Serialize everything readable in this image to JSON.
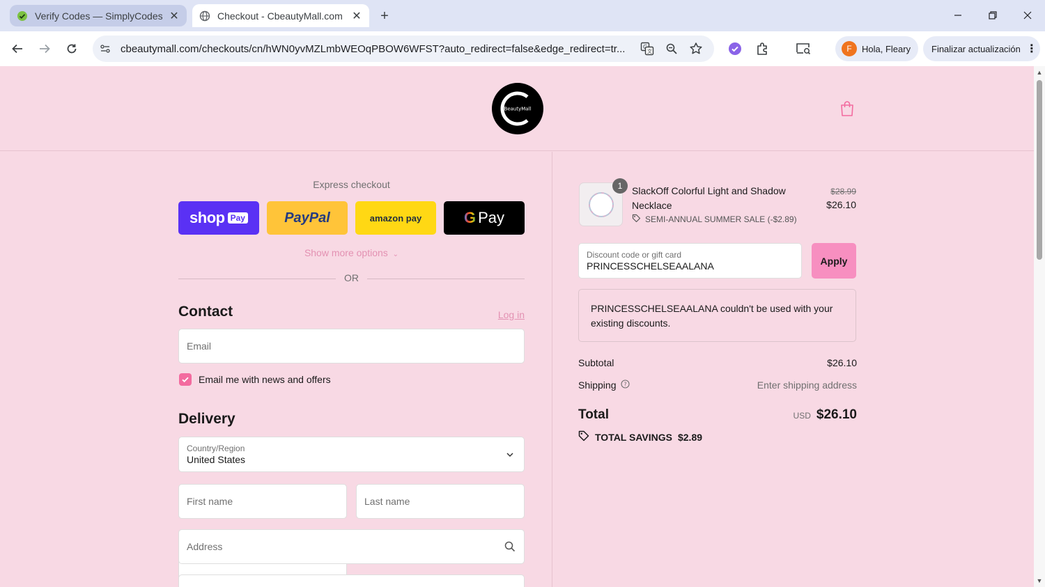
{
  "browser": {
    "tabs": [
      {
        "title": "Verify Codes — SimplyCodes",
        "active": false,
        "icon": "simplycodes-icon"
      },
      {
        "title": "Checkout - CbeautyMall.com",
        "active": true,
        "icon": "globe-icon"
      }
    ],
    "url": "cbeautymall.com/checkouts/cn/hWN0yvMZLmbWEOqPBOW6WFST?auto_redirect=false&edge_redirect=tr...",
    "profile_label": "Hola, Fleary",
    "profile_initial": "F",
    "update_label": "Finalizar actualización"
  },
  "store": {
    "logo_text": "BeautyMall",
    "brand_color": "#f8d9e4",
    "accent_color": "#f36b9f"
  },
  "express": {
    "label": "Express checkout",
    "buttons": [
      {
        "name": "shop-pay",
        "text": "shop",
        "badge": "Pay"
      },
      {
        "name": "paypal",
        "text": "PayPal"
      },
      {
        "name": "amazon-pay",
        "text": "amazon pay"
      },
      {
        "name": "google-pay",
        "text": "Pay"
      }
    ],
    "show_more": "Show more options",
    "or": "OR"
  },
  "contact": {
    "title": "Contact",
    "login": "Log in",
    "email_placeholder": "Email",
    "newsletter_label": "Email me with news and offers",
    "newsletter_checked": true
  },
  "delivery": {
    "title": "Delivery",
    "country_label": "Country/Region",
    "country_value": "United States",
    "first_name_placeholder": "First name",
    "last_name_placeholder": "Last name",
    "address_placeholder": "Address"
  },
  "order": {
    "item": {
      "name": "SlackOff Colorful Light and Shadow Necklace",
      "quantity": "1",
      "discount": "SEMI-ANNUAL SUMMER SALE (-$2.89)",
      "price_old": "$28.99",
      "price_new": "$26.10"
    },
    "discount_label": "Discount code or gift card",
    "discount_value": "PRINCESSCHELSEAALANA",
    "apply_label": "Apply",
    "error_code": "PRINCESSCHELSEAALANA",
    "error_text": " couldn't be used with your existing discounts.",
    "subtotal_label": "Subtotal",
    "subtotal_value": "$26.10",
    "shipping_label": "Shipping",
    "shipping_value": "Enter shipping address",
    "total_label": "Total",
    "total_currency": "USD",
    "total_value": "$26.10",
    "savings_label": "TOTAL SAVINGS",
    "savings_value": "$2.89"
  }
}
